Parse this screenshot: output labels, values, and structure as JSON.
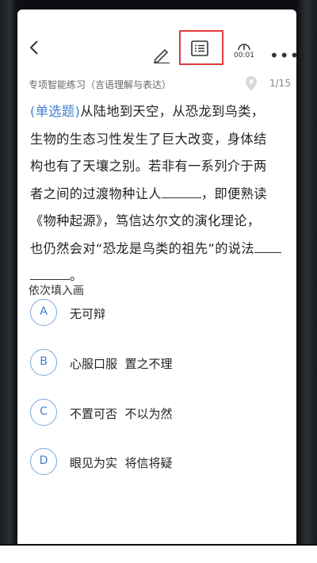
{
  "header": {
    "timer": "00:01"
  },
  "section": {
    "title": "专项智能练习（言语理解与表达）",
    "progress": "1/15"
  },
  "question": {
    "type_label": "(单选题)",
    "line1": "从陆地到天空，从恐龙到鸟类，",
    "line2": "生物的生态习性发生了巨大改变，身体结",
    "line3": "构也有了天壤之别。若非有一系列介于两",
    "line4a": "者之间的过渡物种让人",
    "line4b": "，即便熟读",
    "line5": "《物种起源》，笃信达尔文的演化理论，",
    "line6": "也仍然会对“恐龙是鸟类的祖先”的说法",
    "line7": "。"
  },
  "prompt": "依次填入画",
  "options": [
    {
      "letter": "A",
      "text": "无可辩"
    },
    {
      "letter": "B",
      "text": "心服口服  置之不理"
    },
    {
      "letter": "C",
      "text": "不置可否  不以为然"
    },
    {
      "letter": "D",
      "text": "眼见为实  将信将疑"
    }
  ]
}
